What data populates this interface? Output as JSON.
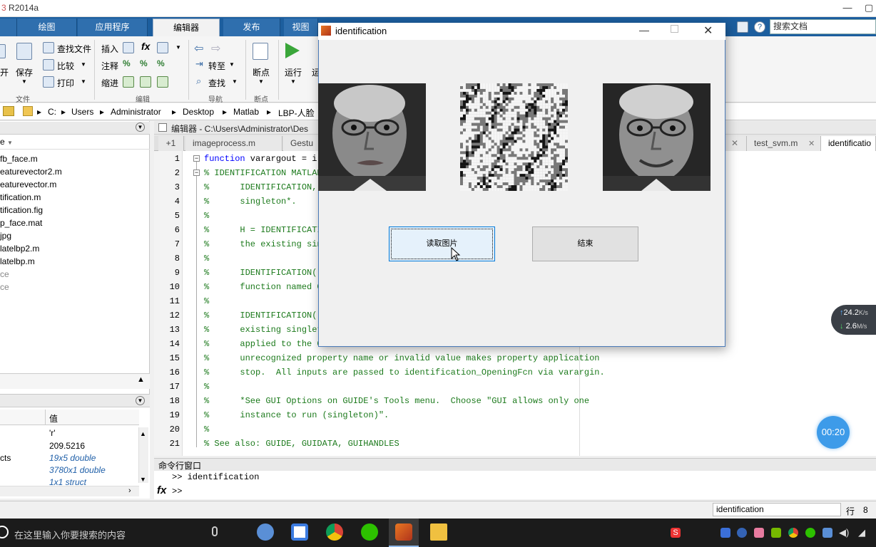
{
  "app": {
    "title": "R2014a",
    "minimize": "—",
    "restore": "▢"
  },
  "ribbon": {
    "tabs": [
      "绘图",
      "应用程序",
      "编辑器",
      "发布",
      "视图"
    ],
    "active_tab": "编辑器",
    "search_placeholder": "搜索文档",
    "file_group": {
      "open": "开",
      "save": "保存",
      "label": "文件"
    },
    "nav_group": {
      "find_files": "查找文件",
      "compare": "比较",
      "print": "打印"
    },
    "edit_group": {
      "insert": "插入",
      "comment": "注释",
      "indent": "缩进",
      "fx": "fx",
      "label": "编辑"
    },
    "navigate_group": {
      "goto": "转至",
      "find": "查找",
      "label": "导航"
    },
    "breakpoint_group": {
      "breakpoints": "断点",
      "label": "断点"
    },
    "run_group": {
      "run": "运行",
      "advance": "运"
    }
  },
  "address": {
    "crumbs": [
      "C:",
      "Users",
      "Administrator",
      "Desktop",
      "Matlab",
      "LBP-人脸"
    ]
  },
  "file_browser": {
    "items": [
      "fb_face.m",
      "eaturevector2.m",
      "eaturevector.m",
      "tification.m",
      "tification.fig",
      "p_face.mat",
      "jpg",
      "latelbp2.m",
      "latelbp.m",
      "ce",
      "ce"
    ]
  },
  "workspace": {
    "col_value": "值",
    "rows": [
      {
        "name": "",
        "value": "'r'",
        "italic": false
      },
      {
        "name": "",
        "value": "209.5216",
        "italic": false
      },
      {
        "name": "cts",
        "value": "19x5 double",
        "italic": true
      },
      {
        "name": "",
        "value": "3780x1 double",
        "italic": true
      },
      {
        "name": "",
        "value": "1x1 struct",
        "italic": true
      }
    ]
  },
  "editor": {
    "header": "编辑器 - C:\\Users\\Administrator\\Des",
    "tabs": [
      "imageprocess.m",
      "Gestu",
      "test_svm.m",
      "identificatio"
    ],
    "plus": "+1",
    "lines": [
      "function varargout = i",
      "% IDENTIFICATION MATLAB",
      "%      IDENTIFICATION,",
      "%      singleton*.",
      "%",
      "%      H = IDENTIFICATI",
      "%      the existing sin",
      "%",
      "%      IDENTIFICATION('",
      "%      function named C",
      "%",
      "%      IDENTIFICATION('",
      "%      existing singlet",
      "%      applied to the G",
      "%      unrecognized property name or invalid value makes property application",
      "%      stop.  All inputs are passed to identification_OpeningFcn via varargin.",
      "%",
      "%      *See GUI Options on GUIDE's Tools menu.  Choose \"GUI allows only one",
      "%      instance to run (singleton)\".",
      "%",
      "% See also: GUIDE, GUIDATA, GUIHANDLES"
    ]
  },
  "command": {
    "title": "命令行窗口",
    "history": ">> identification",
    "prompt": ">>"
  },
  "statusbar": {
    "current": "identification",
    "row_label": "行",
    "row_value": "8"
  },
  "figure": {
    "title": "identification",
    "read_button": "读取图片",
    "end_button": "结束"
  },
  "taskbar": {
    "search_placeholder": "在这里输入你要搜索的内容"
  },
  "net_widget": {
    "up": "24.2",
    "up_unit": "K/s",
    "down": "2.6",
    "down_unit": "M/s"
  },
  "timer": "00:20",
  "colors": {
    "accent": "#1c5e9e",
    "comment": "#1c7a1c",
    "focus": "#0078d7"
  }
}
